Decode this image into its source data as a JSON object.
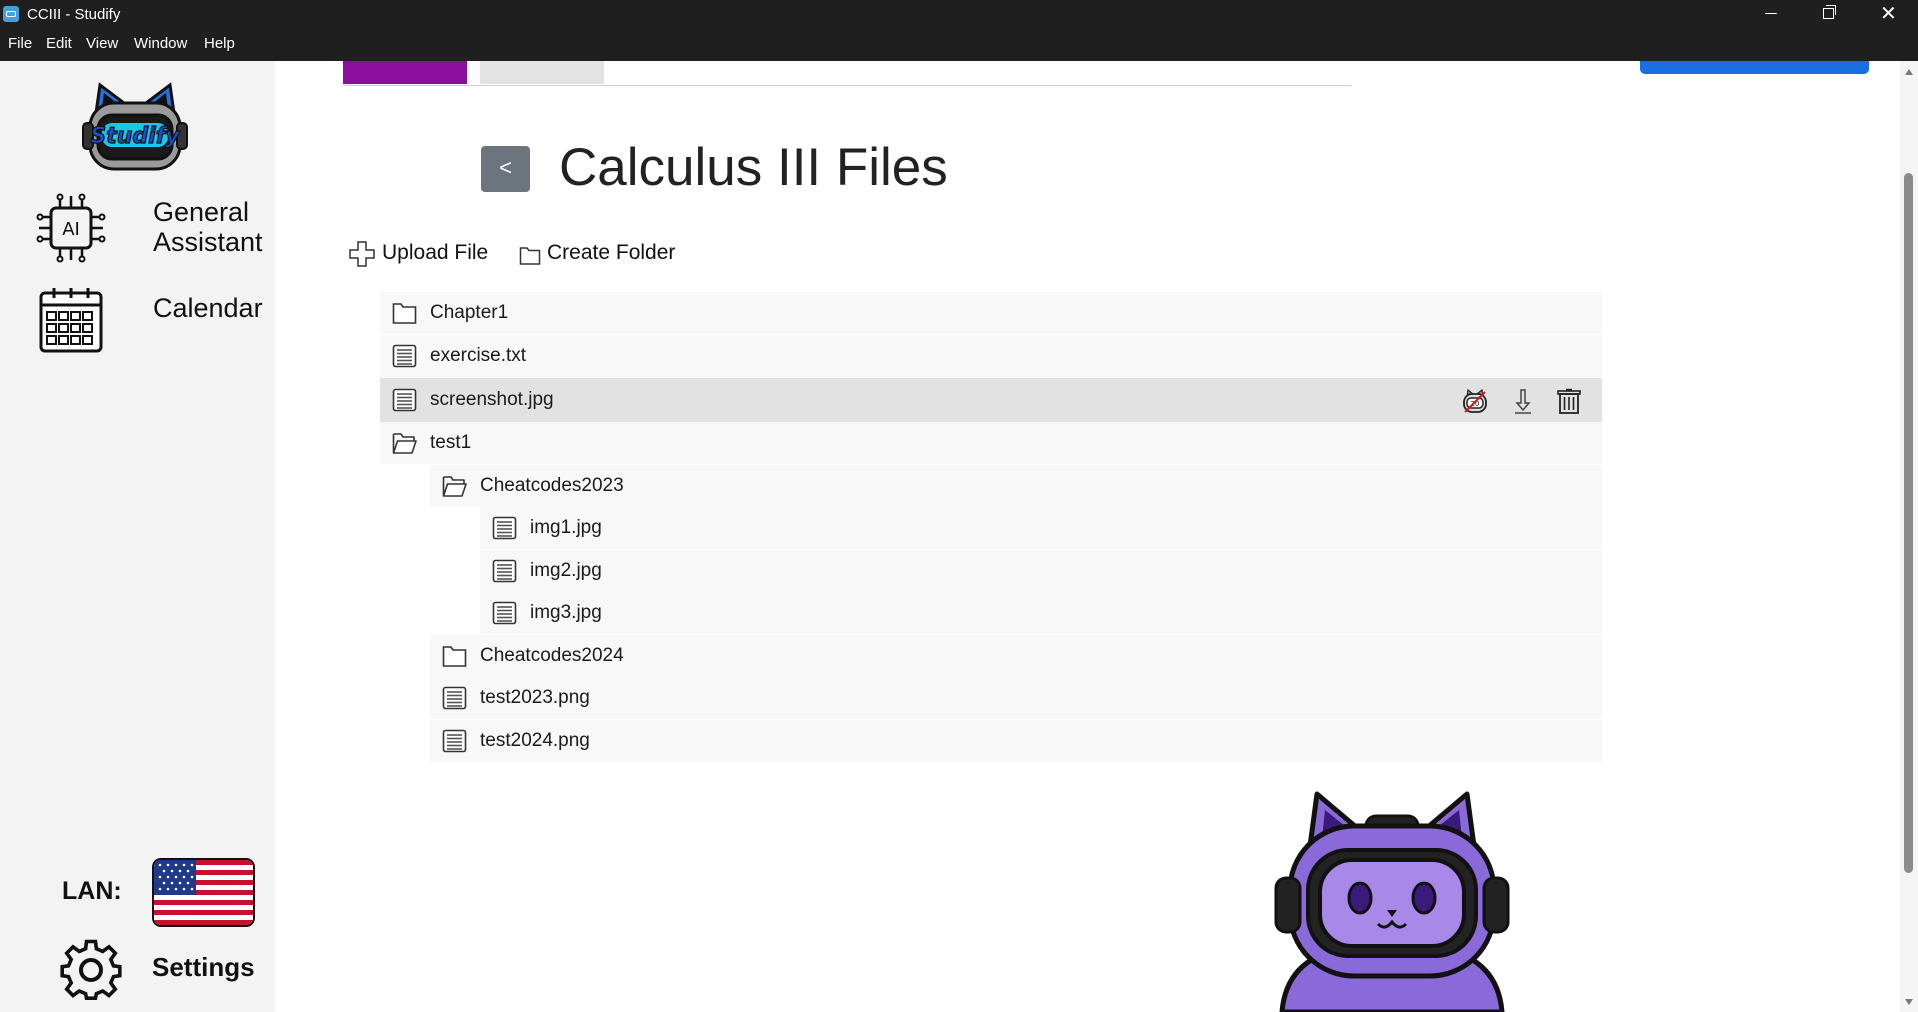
{
  "window": {
    "title": "CCIII - Studify",
    "minimize_icon": "minimize-icon",
    "maximize_icon": "restore-icon",
    "close_icon": "close-icon",
    "close_glyph": "✕"
  },
  "menu": {
    "items": [
      "File",
      "Edit",
      "View",
      "Window",
      "Help"
    ]
  },
  "sidebar": {
    "logo_text": "Studify",
    "nav": [
      {
        "label": "General Assistant",
        "icon": "ai-chip-icon"
      },
      {
        "label": "Calendar",
        "icon": "calendar-icon"
      }
    ],
    "language_label": "LAN:",
    "language_flag": "us-flag-icon",
    "settings_label": "Settings",
    "settings_icon": "gear-icon"
  },
  "main": {
    "back_label": "<",
    "title": "Calculus III Files",
    "upload_label": "Upload File",
    "create_folder_label": "Create Folder",
    "accent_color": "#8a0f9e",
    "primary_color": "#1a6fe0"
  },
  "tree": [
    {
      "name": "Chapter1",
      "type": "folder",
      "level": 0,
      "expanded": false
    },
    {
      "name": "exercise.txt",
      "type": "file",
      "level": 0
    },
    {
      "name": "screenshot.jpg",
      "type": "file",
      "level": 0,
      "selected": true,
      "actions": [
        "ai-study-icon",
        "download-icon",
        "delete-icon"
      ]
    },
    {
      "name": "test1",
      "type": "folder",
      "level": 0,
      "expanded": true
    },
    {
      "name": "Cheatcodes2023",
      "type": "folder",
      "level": 1,
      "expanded": true
    },
    {
      "name": "img1.jpg",
      "type": "file",
      "level": 2
    },
    {
      "name": "img2.jpg",
      "type": "file",
      "level": 2
    },
    {
      "name": "img3.jpg",
      "type": "file",
      "level": 2
    },
    {
      "name": "Cheatcodes2024",
      "type": "folder",
      "level": 1,
      "expanded": false
    },
    {
      "name": "test2023.png",
      "type": "file",
      "level": 1
    },
    {
      "name": "test2024.png",
      "type": "file",
      "level": 1
    }
  ],
  "mascot": "cat-robot-mascot"
}
